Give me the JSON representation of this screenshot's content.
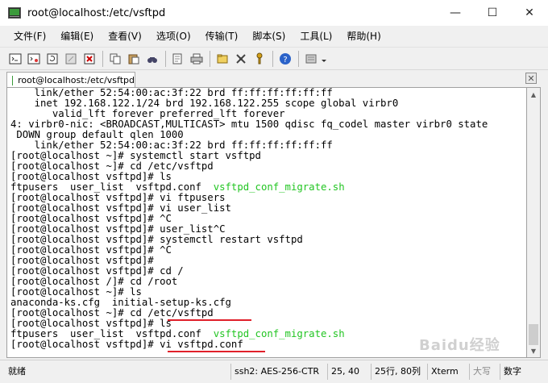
{
  "window": {
    "title": "root@localhost:/etc/vsftpd",
    "minimize": "—",
    "maximize": "☐",
    "close": "✕"
  },
  "menu": [
    "文件(F)",
    "编辑(E)",
    "查看(V)",
    "选项(O)",
    "传输(T)",
    "脚本(S)",
    "工具(L)",
    "帮助(H)"
  ],
  "toolbar_icons": [
    "new-session-icon",
    "open-session-icon",
    "reconnect-icon",
    "disconnect-icon",
    "close-tab-icon",
    "copy-icon",
    "paste-icon",
    "find-icon",
    "print-setup-icon",
    "print-icon",
    "sftp-icon",
    "properties-icon",
    "keymap-icon",
    "key-agent-icon",
    "help-icon",
    "lock-icon"
  ],
  "tab": {
    "label": "root@localhost:/etc/vsftpd",
    "close": "✕"
  },
  "terminal": {
    "lines": [
      [
        {
          "t": "    link/ether 52:54:00:ac:3f:22 brd ff:ff:ff:ff:ff:ff"
        }
      ],
      [
        {
          "t": "    inet 192.168.122.1/24 brd 192.168.122.255 scope global virbr0"
        }
      ],
      [
        {
          "t": "       valid_lft forever preferred_lft forever"
        }
      ],
      [
        {
          "t": "4: virbr0-nic: <BROADCAST,MULTICAST> mtu 1500 qdisc fq_codel master virbr0 state"
        }
      ],
      [
        {
          "t": " DOWN group default qlen 1000"
        }
      ],
      [
        {
          "t": "    link/ether 52:54:00:ac:3f:22 brd ff:ff:ff:ff:ff:ff"
        }
      ],
      [
        {
          "t": "[root@localhost ~]# systemctl start vsftpd"
        }
      ],
      [
        {
          "t": "[root@localhost ~]# cd /etc/vsftpd"
        }
      ],
      [
        {
          "t": "[root@localhost vsftpd]# ls"
        }
      ],
      [
        {
          "t": "ftpusers  user_list  vsftpd.conf  "
        },
        {
          "t": "vsftpd_conf_migrate.sh",
          "c": "green"
        }
      ],
      [
        {
          "t": "[root@localhost vsftpd]# vi ftpusers"
        }
      ],
      [
        {
          "t": "[root@localhost vsftpd]# vi user_list"
        }
      ],
      [
        {
          "t": "[root@localhost vsftpd]# ^C"
        }
      ],
      [
        {
          "t": "[root@localhost vsftpd]# user_list^C"
        }
      ],
      [
        {
          "t": "[root@localhost vsftpd]# systemctl restart vsftpd"
        }
      ],
      [
        {
          "t": "[root@localhost vsftpd]# ^C"
        }
      ],
      [
        {
          "t": "[root@localhost vsftpd]#"
        }
      ],
      [
        {
          "t": "[root@localhost vsftpd]# cd /"
        }
      ],
      [
        {
          "t": "[root@localhost /]# cd /root"
        }
      ],
      [
        {
          "t": "[root@localhost ~]# ls"
        }
      ],
      [
        {
          "t": "anaconda-ks.cfg  initial-setup-ks.cfg"
        }
      ],
      [
        {
          "t": "[root@localhost ~]# cd /etc/vsftpd"
        }
      ],
      [
        {
          "t": "[root@localhost vsftpd]# ls"
        }
      ],
      [
        {
          "t": "ftpusers  user_list  vsftpd.conf  "
        },
        {
          "t": "vsftpd_conf_migrate.sh",
          "c": "green"
        }
      ],
      [
        {
          "t": "[root@localhost vsftpd]# vi vsftpd.conf"
        }
      ]
    ]
  },
  "status": {
    "ready": "就绪",
    "protocol": "ssh2: AES-256-CTR",
    "cursor": "25,  40",
    "size": "25行, 80列",
    "term": "Xterm",
    "caps": "大写",
    "num": "数字"
  },
  "watermark": "Baidu经验",
  "colors": {
    "annotation_red": "#e0202a",
    "exec_green": "#22c522"
  }
}
